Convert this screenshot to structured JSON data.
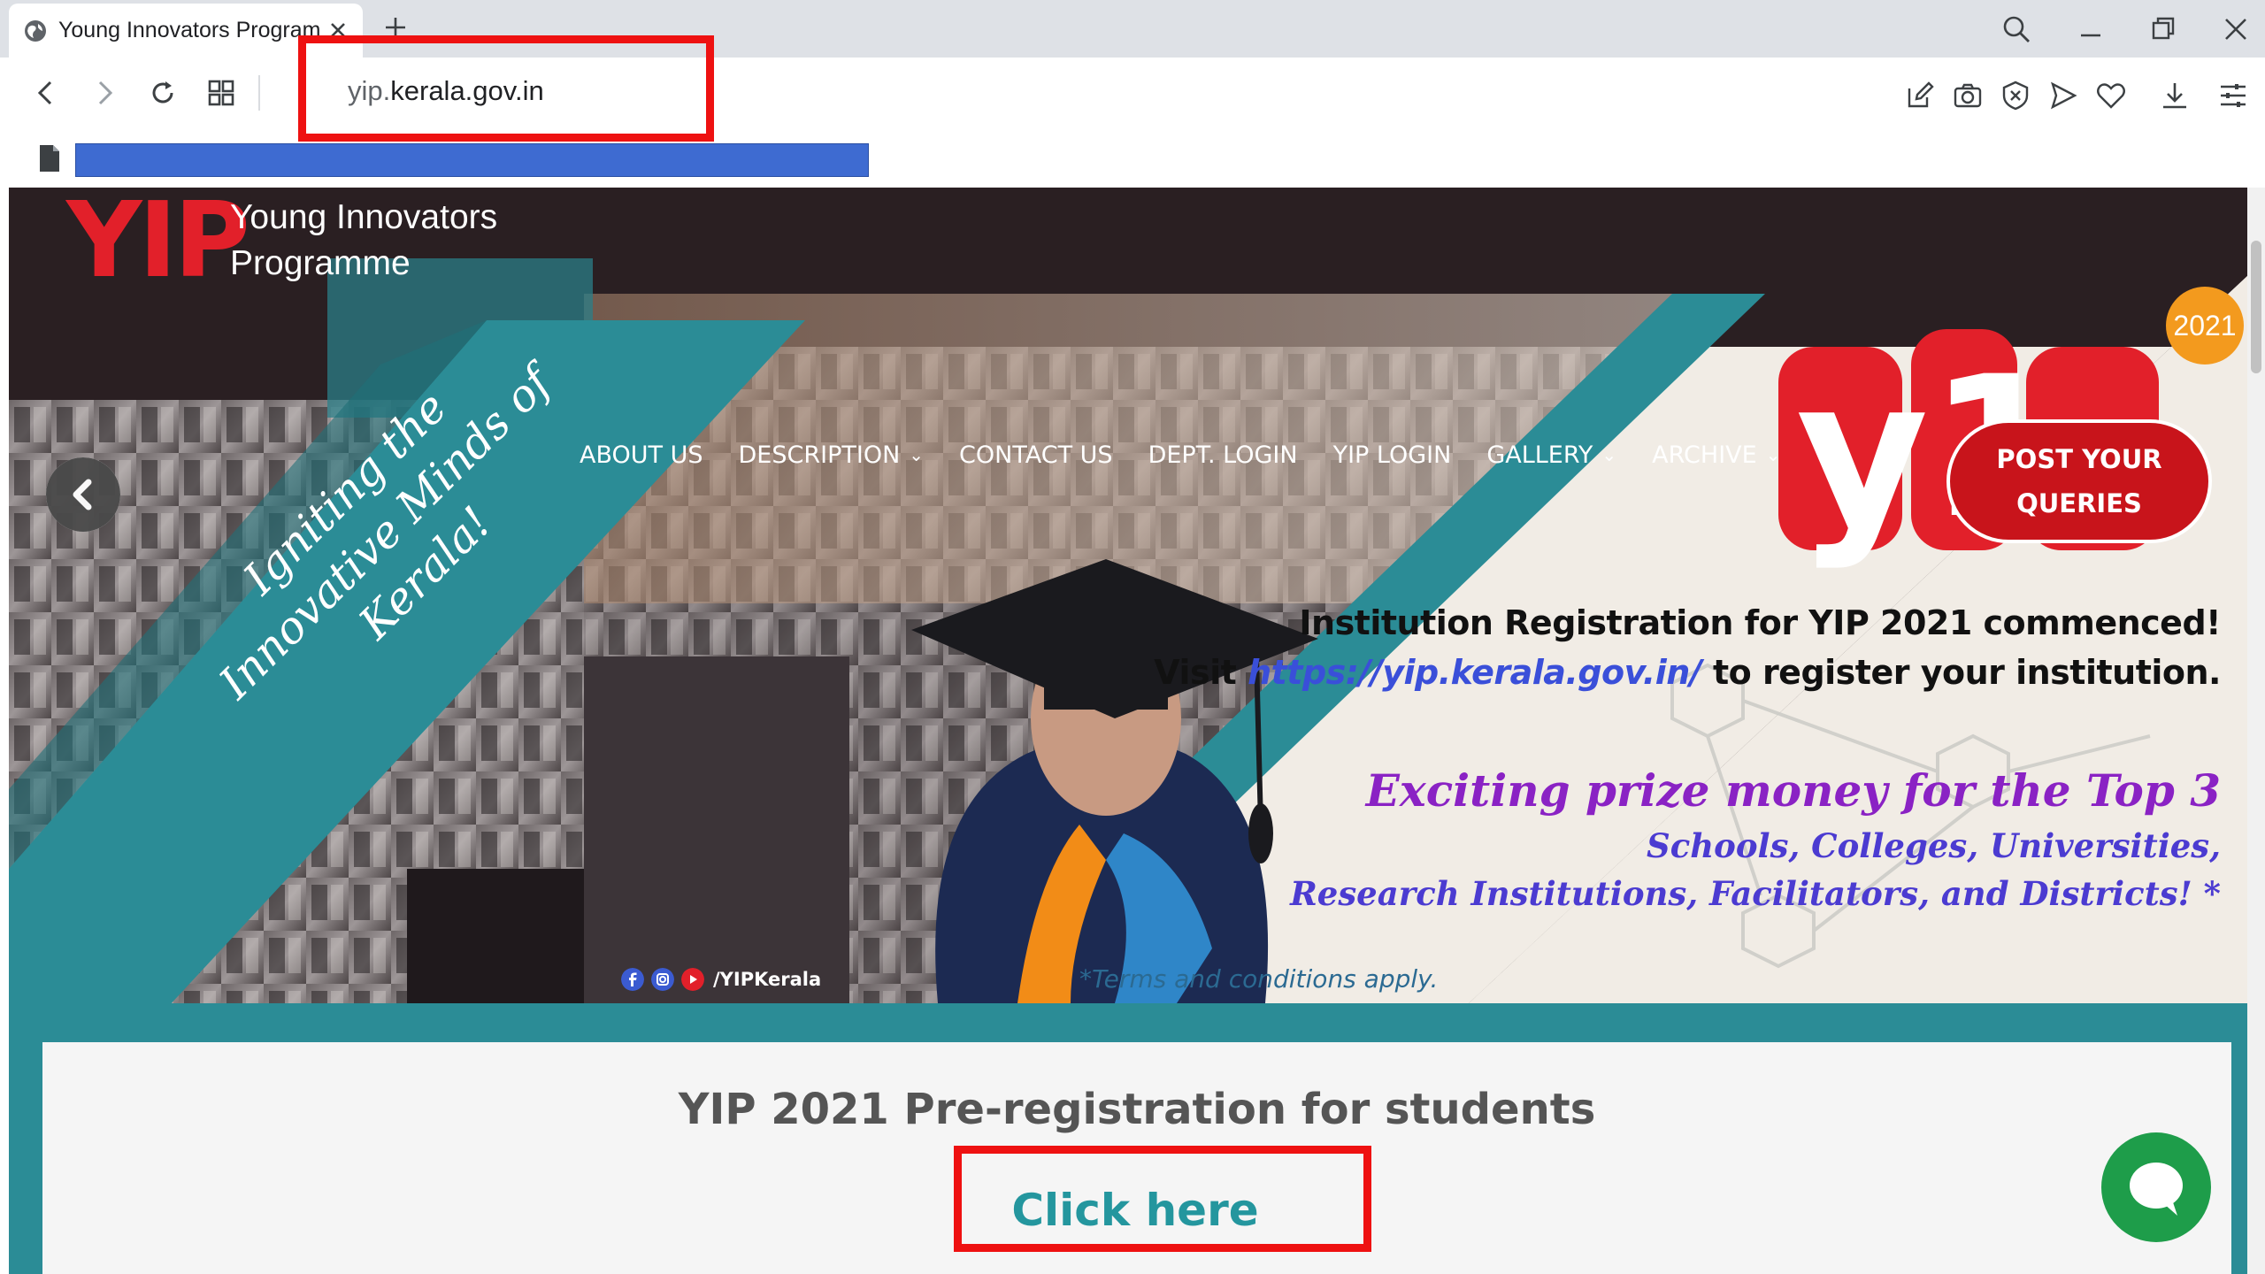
{
  "browser": {
    "tab_title": "Young Innovators Program",
    "url_prefix": "yip.",
    "url_domain": "kerala.gov.in"
  },
  "site": {
    "logo": "YIP",
    "name_line1": "Young Innovators",
    "name_line2": "Programme"
  },
  "nav": {
    "items": [
      {
        "label": "ABOUT US",
        "dropdown": false
      },
      {
        "label": "DESCRIPTION",
        "dropdown": true
      },
      {
        "label": "CONTACT US",
        "dropdown": false
      },
      {
        "label": "DEPT. LOGIN",
        "dropdown": false
      },
      {
        "label": "YIP LOGIN",
        "dropdown": false
      },
      {
        "label": "GALLERY",
        "dropdown": true
      },
      {
        "label": "ARCHIVE",
        "dropdown": true
      }
    ],
    "post_queries_line1": "POST YOUR",
    "post_queries_line2": "QUERIES"
  },
  "hero": {
    "tagline_line1": "Igniting the",
    "tagline_line2": "Innovative Minds of Kerala!",
    "badge_year": "2021",
    "registration_line1": "Institution Registration for YIP 2021 commenced!",
    "registration_visit": "Visit",
    "registration_link": "https://yip.kerala.gov.in/",
    "registration_tail": "to register your institution.",
    "prize_line1": "Exciting prize money for the Top 3",
    "prize_line2": "Schools, Colleges, Universities,",
    "prize_line3": "Research Institutions, Facilitators, and Districts! *",
    "terms": "*Terms and conditions apply.",
    "social_handle": "/YIPKerala"
  },
  "prereg": {
    "title": "YIP 2021 Pre-registration for students",
    "cta": "Click here"
  },
  "colors": {
    "accent_red": "#e2202a",
    "teal": "#2b8c96",
    "highlight_red": "#ee1111",
    "chat_green": "#1e9d4a"
  }
}
